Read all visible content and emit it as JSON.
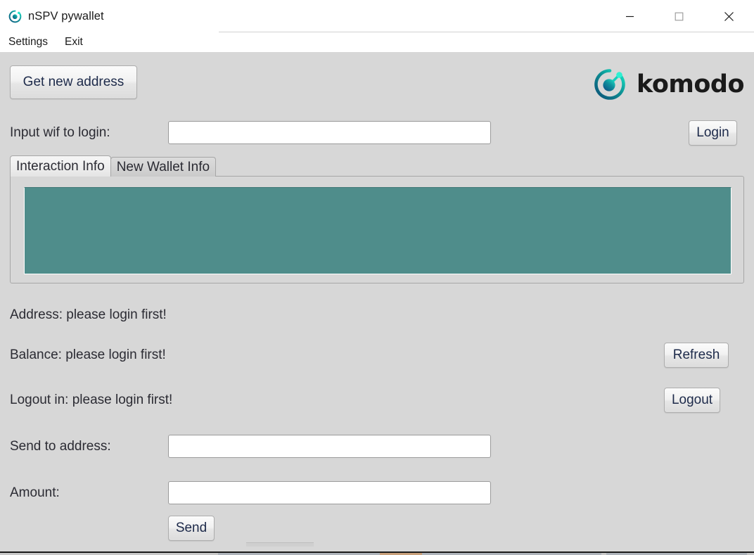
{
  "window": {
    "title": "nSPV pywallet",
    "app_icon": "komodo-circle-icon",
    "controls": {
      "minimize": "minimize-icon",
      "maximize": "maximize-icon",
      "close": "close-icon"
    }
  },
  "menubar": {
    "items": [
      {
        "label": "Settings"
      },
      {
        "label": "Exit"
      }
    ]
  },
  "toolbar": {
    "get_new_address_label": "Get new address"
  },
  "brand": {
    "wordmark": "komodo",
    "mark_icon": "komodo-logo-icon",
    "colors": {
      "ring": "#0f6a74",
      "dot": "#12b8a6",
      "accent": "#19e8c8",
      "word": "#1a1a1a"
    }
  },
  "login": {
    "label": "Input wif to login:",
    "input_value": "",
    "input_placeholder": "",
    "button_label": "Login"
  },
  "tabs": {
    "active_index": 0,
    "items": [
      {
        "label": "Interaction Info"
      },
      {
        "label": "New Wallet Info"
      }
    ]
  },
  "console": {
    "text": "",
    "background": "#4f8d8b"
  },
  "status": {
    "address": "Address: please login first!",
    "balance": "Balance: please login first!",
    "logout": "Logout in: please login first!",
    "refresh_button_label": "Refresh",
    "logout_button_label": "Logout"
  },
  "send": {
    "address_label": "Send to address:",
    "address_value": "",
    "address_placeholder": "",
    "amount_label": "Amount:",
    "amount_value": "",
    "amount_placeholder": "",
    "button_label": "Send"
  }
}
